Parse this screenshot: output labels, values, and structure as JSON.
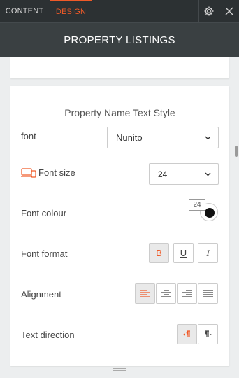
{
  "tabs": {
    "content": "CONTENT",
    "design": "DESIGN"
  },
  "header": {
    "title": "PROPERTY LISTINGS"
  },
  "section": {
    "title": "Property Name Text Style",
    "font": {
      "label": "font",
      "value": "Nunito"
    },
    "font_size": {
      "label": "Font size",
      "value": "24"
    },
    "font_colour": {
      "label": "Font colour",
      "tooltip": "24",
      "color": "#111111"
    },
    "font_format": {
      "label": "Font format",
      "bold": "B",
      "underline": "U",
      "italic": "I"
    },
    "alignment": {
      "label": "Alignment"
    },
    "text_direction": {
      "label": "Text direction"
    }
  },
  "colors": {
    "accent": "#f05a28",
    "topbar": "#2c3133",
    "titlebar": "#3a4042"
  }
}
